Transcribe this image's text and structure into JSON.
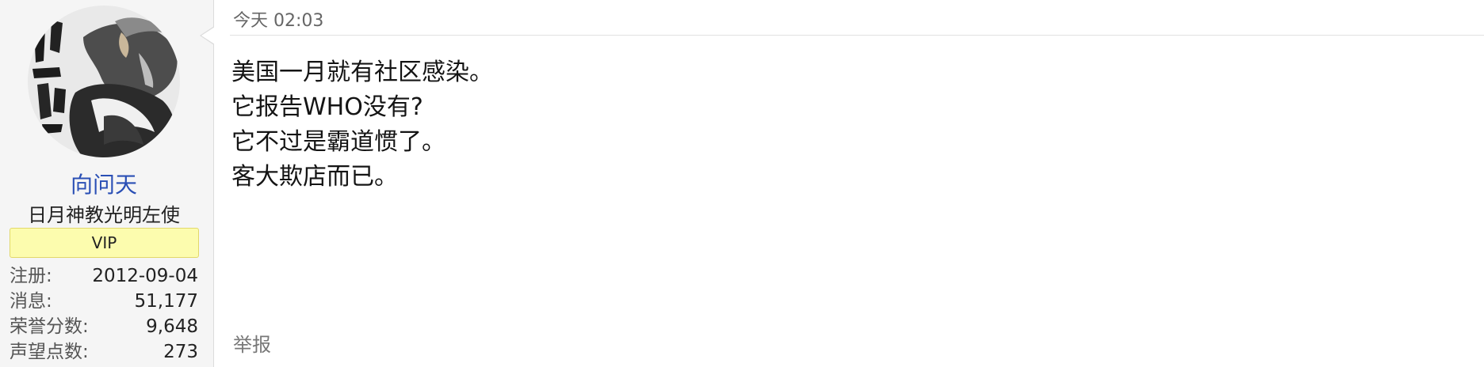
{
  "user": {
    "username": "向问天",
    "title": "日月神教光明左使",
    "badge": "VIP",
    "stats": [
      {
        "label": "注册:",
        "value": "2012-09-04"
      },
      {
        "label": "消息:",
        "value": "51,177"
      },
      {
        "label": "荣誉分数:",
        "value": "9,648"
      },
      {
        "label": "声望点数:",
        "value": "273"
      }
    ]
  },
  "post": {
    "date": "今天 02:03",
    "lines": [
      "美国一月就有社区感染。",
      "它报告WHO没有?",
      "它不过是霸道惯了。",
      "客大欺店而已。"
    ],
    "report_label": "举报"
  },
  "colors": {
    "username": "#2a4fb5",
    "vip_badge_bg": "#fcfcae",
    "sidebar_bg": "#f5f5f5"
  }
}
